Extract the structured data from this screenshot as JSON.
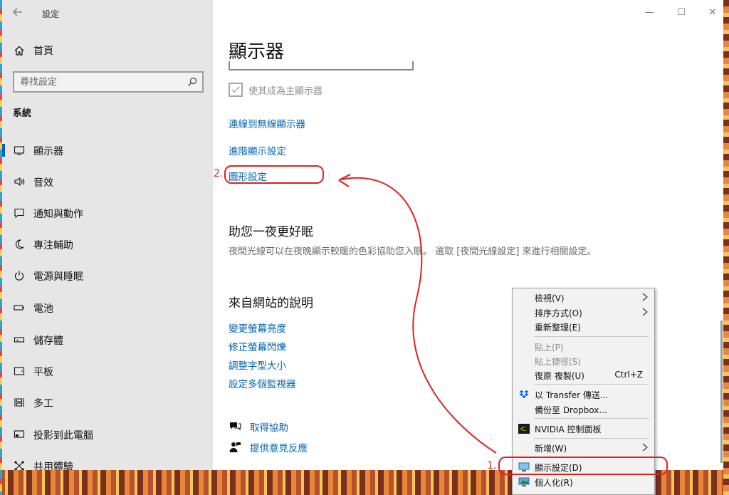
{
  "window": {
    "title": "設定",
    "controls": {
      "minimize": "—",
      "maximize": "☐",
      "close": "✕"
    }
  },
  "sidebar": {
    "home_label": "首頁",
    "search_placeholder": "尋找設定",
    "section_title": "系統",
    "items": [
      {
        "label": "顯示器",
        "icon": "monitor-icon",
        "selected": true
      },
      {
        "label": "音效",
        "icon": "speaker-icon"
      },
      {
        "label": "通知與動作",
        "icon": "message-icon"
      },
      {
        "label": "專注輔助",
        "icon": "moon-icon"
      },
      {
        "label": "電源與睡眠",
        "icon": "power-icon"
      },
      {
        "label": "電池",
        "icon": "battery-icon"
      },
      {
        "label": "儲存體",
        "icon": "storage-icon"
      },
      {
        "label": "平板",
        "icon": "tablet-icon"
      },
      {
        "label": "多工",
        "icon": "multitask-icon"
      },
      {
        "label": "投影到此電腦",
        "icon": "project-icon"
      },
      {
        "label": "共用體驗",
        "icon": "share-icon"
      }
    ]
  },
  "main": {
    "page_title": "顯示器",
    "checkbox_label": "使其成為主顯示器",
    "links": {
      "wireless": "連線到無線顯示器",
      "advanced": "進階顯示設定",
      "graphics": "圖形設定"
    },
    "night_title": "助您一夜更好眠",
    "night_desc": "夜間光線可以在夜晚顯示較暖的色彩協助您入眠。 選取 [夜間光線設定] 來進行相關設定。",
    "web_help_title": "來自網站的說明",
    "web_links": [
      "變更螢幕亮度",
      "修正螢幕閃爍",
      "調整字型大小",
      "設定多個監視器"
    ],
    "get_help": "取得協助",
    "feedback": "提供意見反應"
  },
  "context_menu": {
    "view": "檢視(V)",
    "sort": "排序方式(O)",
    "refresh": "重新整理(E)",
    "paste": "貼上(P)",
    "paste_shortcut": "貼上捷徑(S)",
    "undo": "復原 複製(U)",
    "undo_shortcut": "Ctrl+Z",
    "transfer": "以 Transfer 傳送...",
    "dropbox": "備份至 Dropbox...",
    "nvidia": "NVIDIA 控制面板",
    "new": "新增(W)",
    "display_settings": "顯示設定(D)",
    "personalize": "個人化(R)"
  },
  "annotations": {
    "step1": "1.",
    "step2": "2.",
    "color": "#e02020"
  },
  "colors": {
    "accent": "#0063b1",
    "sidebar_bg": "#e6e6e6",
    "annotation": "#e02020"
  }
}
